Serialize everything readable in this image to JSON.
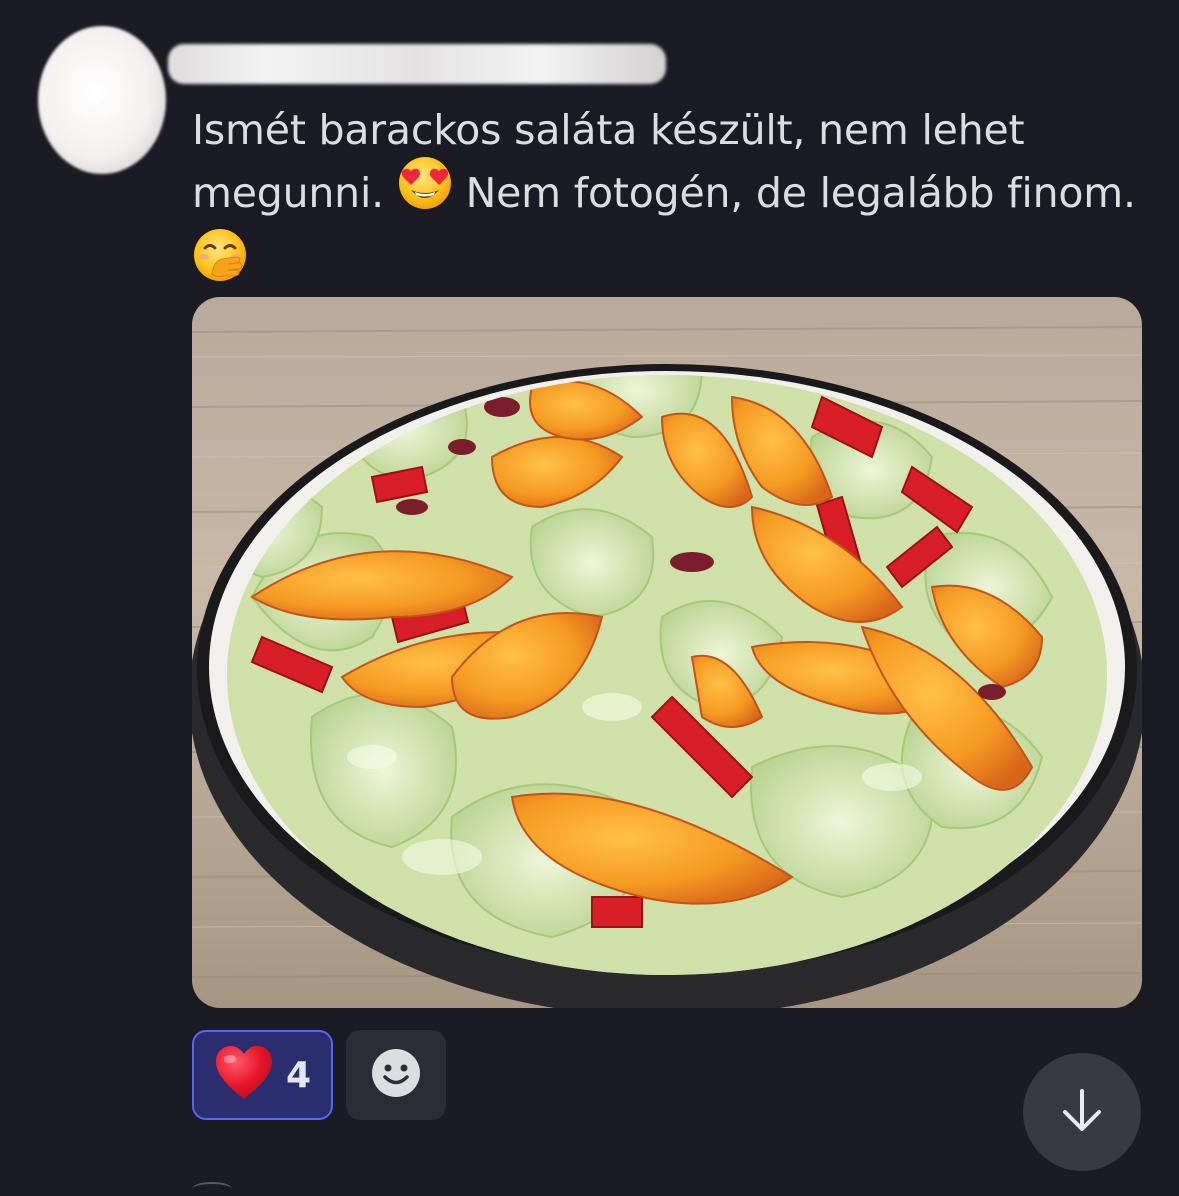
{
  "message": {
    "author_name": "",
    "text_part_1": "Ismét barackos saláta készült, nem lehet megunni.",
    "text_part_2": "Nem fotogén, de legalább finom.",
    "emoji_1": "heart-eyes-emoji",
    "emoji_2": "hand-over-mouth-emoji"
  },
  "attachment": {
    "kind": "photo",
    "subject": "salad-bowl"
  },
  "reactions": [
    {
      "emoji": "heart-emoji",
      "count": "4",
      "selected": true
    }
  ],
  "add_reaction": {
    "icon": "smiley-icon"
  },
  "scroll_button": {
    "icon": "arrow-down-icon"
  },
  "colors": {
    "background": "#1b1c23",
    "text": "#dcdde1",
    "reaction_selected_bg": "#2a2e6e",
    "reaction_selected_border": "#5865f2",
    "reaction_bg": "#2b2d35",
    "fab_bg": "#383942"
  }
}
